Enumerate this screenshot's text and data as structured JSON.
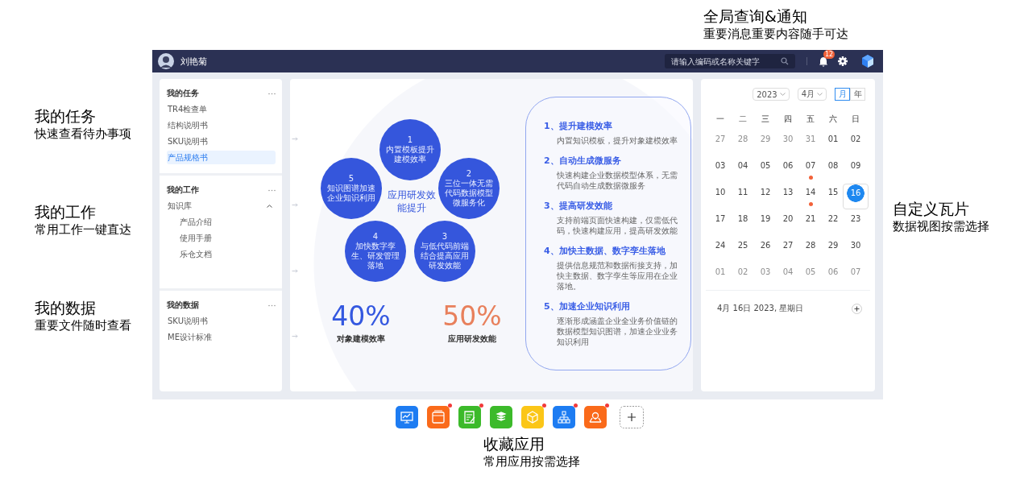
{
  "annotations": {
    "top": {
      "title": "全局查询&通知",
      "subtitle": "重要消息重要内容随手可达"
    },
    "left": [
      {
        "title": "我的任务",
        "subtitle": "快速查看待办事项"
      },
      {
        "title": "我的工作",
        "subtitle": "常用工作一键直达"
      },
      {
        "title": "我的数据",
        "subtitle": "重要文件随时查看"
      }
    ],
    "right": {
      "title": "自定义瓦片",
      "subtitle": "数据视图按需选择"
    },
    "bottom": {
      "title": "收藏应用",
      "subtitle": "常用应用按需选择"
    }
  },
  "header": {
    "user_name": "刘艳菊",
    "search_placeholder": "请输入编码或名称关键字",
    "notification_count": "12"
  },
  "sidebar": [
    {
      "title": "我的任务",
      "items": [
        {
          "label": "TR4检查单",
          "selected": false
        },
        {
          "label": "结构说明书",
          "selected": false
        },
        {
          "label": "SKU说明书",
          "selected": false
        },
        {
          "label": "产品规格书",
          "selected": true
        }
      ]
    },
    {
      "title": "我的工作",
      "items": [
        {
          "label": "知识库",
          "selected": false,
          "expanded": true,
          "children": [
            {
              "label": "产品介绍",
              "selected": false
            },
            {
              "label": "使用手册",
              "selected": false
            },
            {
              "label": "乐仓文档",
              "selected": false
            }
          ]
        }
      ]
    },
    {
      "title": "我的数据",
      "items": [
        {
          "label": "SKU说明书",
          "selected": false
        },
        {
          "label": "ME设计标准",
          "selected": false
        }
      ]
    }
  ],
  "main": {
    "center_text": "应用研发效能提升",
    "circles": [
      {
        "number": "1",
        "text": "内置模板提升建模效率"
      },
      {
        "number": "5",
        "text": "知识图谱加速企业知识利用"
      },
      {
        "number": "2",
        "text": "三位一体无需代码数据模型微服务化"
      },
      {
        "number": "4",
        "text": "加快数字孪生、研发管理落地"
      },
      {
        "number": "3",
        "text": "与低代码前端结合提高应用研发效能"
      }
    ],
    "stats": [
      {
        "value": "40%",
        "label": "对象建模效率",
        "color": "#3458e0"
      },
      {
        "value": "50%",
        "label": "应用研发效能",
        "color": "#e8805c"
      }
    ],
    "features": [
      {
        "title": "1、提升建模效率",
        "description": "内置知识模板，提升对象建模效率"
      },
      {
        "title": "2、自动生成微服务",
        "description": "快速构建企业数据模型体系，无需代码自动生成数据微服务"
      },
      {
        "title": "3、提高研发效能",
        "description": "支持前端页面快速构建，仅需低代码，快速构建应用，提高研发效能"
      },
      {
        "title": "4、加快主数据、数字孪生落地",
        "description": "提供信息规范和数据衔接支持，加快主数据、数字孪生等应用在企业落地。"
      },
      {
        "title": "5、加速企业知识利用",
        "description": "逐渐形成涵盖企业全业务价值链的数据模型知识图谱，加速企业业务知识利用"
      }
    ]
  },
  "calendar": {
    "year": "2023",
    "month": "4月",
    "views": [
      {
        "label": "月",
        "selected": true
      },
      {
        "label": "年",
        "selected": false
      }
    ],
    "weekdays": [
      "一",
      "二",
      "三",
      "四",
      "五",
      "六",
      "日"
    ],
    "weeks": [
      [
        {
          "day": "27",
          "muted": true,
          "selected": false,
          "event": false
        },
        {
          "day": "28",
          "muted": true,
          "selected": false,
          "event": false
        },
        {
          "day": "29",
          "muted": true,
          "selected": false,
          "event": false
        },
        {
          "day": "30",
          "muted": true,
          "selected": false,
          "event": false
        },
        {
          "day": "31",
          "muted": true,
          "selected": false,
          "event": false
        },
        {
          "day": "01",
          "muted": false,
          "selected": false,
          "event": false
        },
        {
          "day": "02",
          "muted": false,
          "selected": false,
          "event": false
        }
      ],
      [
        {
          "day": "03",
          "muted": false,
          "selected": false,
          "event": false
        },
        {
          "day": "04",
          "muted": false,
          "selected": false,
          "event": false
        },
        {
          "day": "05",
          "muted": false,
          "selected": false,
          "event": false
        },
        {
          "day": "06",
          "muted": false,
          "selected": false,
          "event": false
        },
        {
          "day": "07",
          "muted": false,
          "selected": false,
          "event": true
        },
        {
          "day": "08",
          "muted": false,
          "selected": false,
          "event": false
        },
        {
          "day": "09",
          "muted": false,
          "selected": false,
          "event": false
        }
      ],
      [
        {
          "day": "10",
          "muted": false,
          "selected": false,
          "event": false
        },
        {
          "day": "11",
          "muted": false,
          "selected": false,
          "event": false
        },
        {
          "day": "12",
          "muted": false,
          "selected": false,
          "event": false
        },
        {
          "day": "13",
          "muted": false,
          "selected": false,
          "event": false
        },
        {
          "day": "14",
          "muted": false,
          "selected": false,
          "event": true
        },
        {
          "day": "15",
          "muted": false,
          "selected": false,
          "event": false
        },
        {
          "day": "16",
          "muted": false,
          "selected": true,
          "event": false
        }
      ],
      [
        {
          "day": "17",
          "muted": false,
          "selected": false,
          "event": false
        },
        {
          "day": "18",
          "muted": false,
          "selected": false,
          "event": false
        },
        {
          "day": "19",
          "muted": false,
          "selected": false,
          "event": false
        },
        {
          "day": "20",
          "muted": false,
          "selected": false,
          "event": false
        },
        {
          "day": "21",
          "muted": false,
          "selected": false,
          "event": false
        },
        {
          "day": "22",
          "muted": false,
          "selected": false,
          "event": false
        },
        {
          "day": "23",
          "muted": false,
          "selected": false,
          "event": false
        }
      ],
      [
        {
          "day": "24",
          "muted": false,
          "selected": false,
          "event": false
        },
        {
          "day": "25",
          "muted": false,
          "selected": false,
          "event": false
        },
        {
          "day": "26",
          "muted": false,
          "selected": false,
          "event": false
        },
        {
          "day": "27",
          "muted": false,
          "selected": false,
          "event": false
        },
        {
          "day": "28",
          "muted": false,
          "selected": false,
          "event": false
        },
        {
          "day": "29",
          "muted": false,
          "selected": false,
          "event": false
        },
        {
          "day": "30",
          "muted": false,
          "selected": false,
          "event": false
        }
      ],
      [
        {
          "day": "01",
          "muted": true,
          "selected": false,
          "event": false
        },
        {
          "day": "02",
          "muted": true,
          "selected": false,
          "event": false
        },
        {
          "day": "03",
          "muted": true,
          "selected": false,
          "event": false
        },
        {
          "day": "04",
          "muted": true,
          "selected": false,
          "event": false
        },
        {
          "day": "05",
          "muted": true,
          "selected": false,
          "event": false
        },
        {
          "day": "06",
          "muted": true,
          "selected": false,
          "event": false
        },
        {
          "day": "07",
          "muted": true,
          "selected": false,
          "event": false
        }
      ]
    ],
    "footer_date": "4月 16日 2023, 星期日"
  },
  "dock": [
    {
      "kind": "monitor",
      "color": "#1d7cf2",
      "badge": false
    },
    {
      "kind": "window",
      "color": "#fa6a1a",
      "badge": true
    },
    {
      "kind": "note",
      "color": "#3cba2a",
      "badge": true
    },
    {
      "kind": "layers",
      "color": "#3cba2a",
      "badge": false
    },
    {
      "kind": "cube",
      "color": "#fbc617",
      "badge": true
    },
    {
      "kind": "hierarchy",
      "color": "#1d7cf2",
      "badge": true
    },
    {
      "kind": "pin",
      "color": "#fa6a1a",
      "badge": true
    }
  ]
}
